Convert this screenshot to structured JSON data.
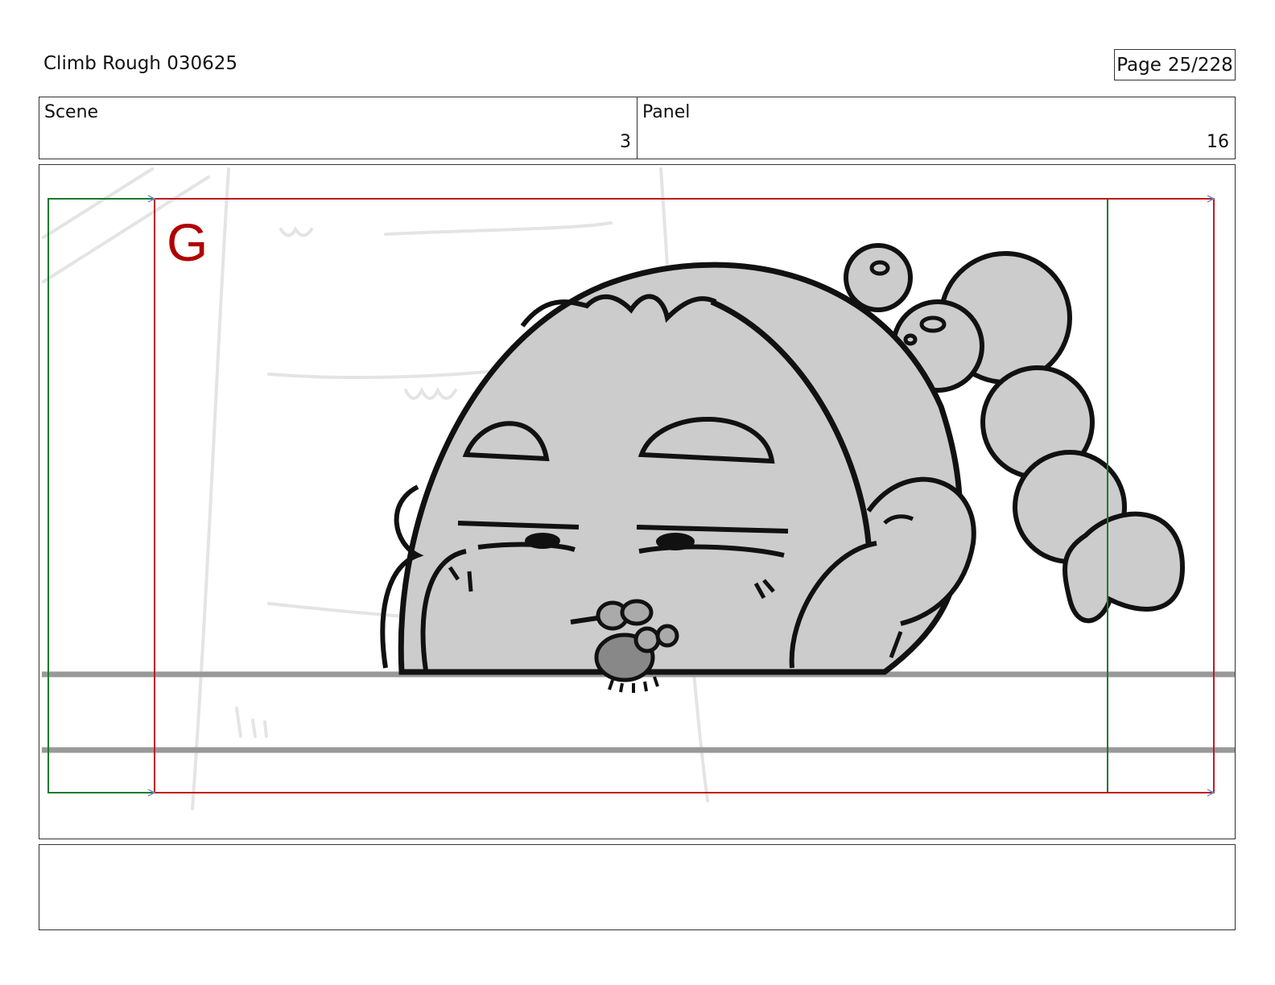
{
  "document": {
    "title": "Climb Rough 030625",
    "page_label": "Page",
    "page_value": "25/228"
  },
  "info": {
    "scene_label": "Scene",
    "scene_value": "3",
    "panel_label": "Panel",
    "panel_value": "16"
  },
  "panel": {
    "field_label": "G",
    "colors": {
      "safe_frame": "#c0191e",
      "camera_frame": "#1a7a2a",
      "sketch_fill": "#cccccc",
      "ink": "#111111",
      "ledge": "#999999"
    }
  },
  "notes": {
    "text": ""
  }
}
